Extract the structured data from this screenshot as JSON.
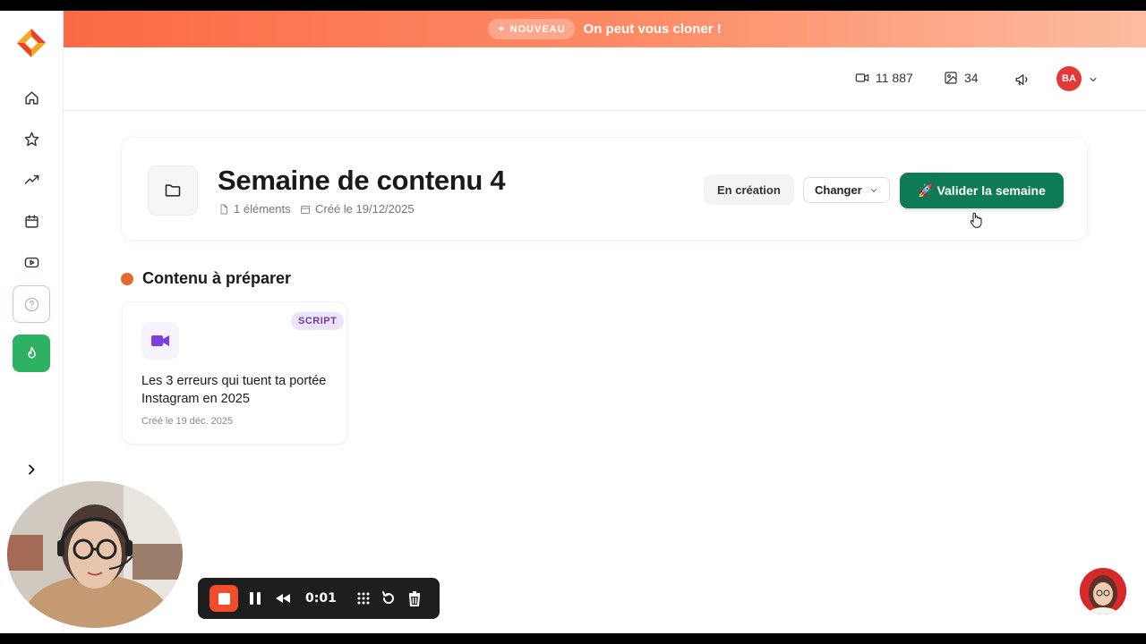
{
  "banner": {
    "badge": "✦ NOUVEAU",
    "text": "On peut vous cloner !"
  },
  "topbar": {
    "videos_count": "11 887",
    "images_count": "34",
    "avatar_initials": "BA"
  },
  "sidebar": {
    "items": [
      "home-icon",
      "star-icon",
      "trending-icon",
      "calendar-icon",
      "youtube-icon",
      "help-icon",
      "fire-icon"
    ]
  },
  "header": {
    "title": "Semaine de contenu 4",
    "elements": "1 éléments",
    "created": "Créé le 19/12/2025",
    "status": "En création",
    "change_label": "Changer",
    "validate_label": "🚀 Valider la semaine"
  },
  "section": {
    "title": "Contenu à préparer"
  },
  "card": {
    "tag": "SCRIPT",
    "title": "Les 3 erreurs qui tuent ta portée Instagram en 2025",
    "date": "Créé le 19 déc. 2025"
  },
  "recorder": {
    "time": "0:01"
  },
  "colors": {
    "accent_green": "#0e7a56",
    "banner_orange": "#fb6a45",
    "section_dot": "#e66a2c",
    "avatar_red": "#e5383b"
  }
}
